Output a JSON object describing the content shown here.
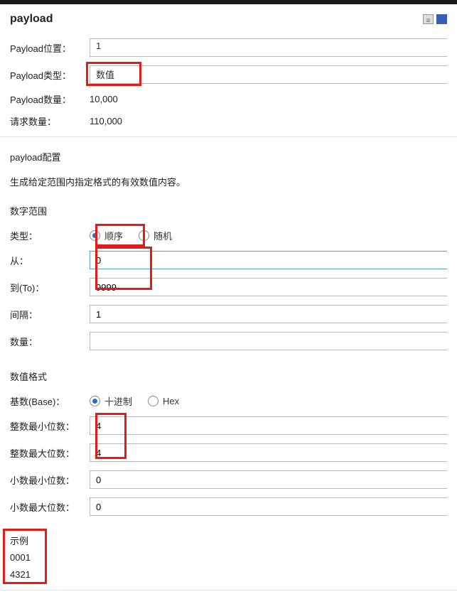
{
  "header": {
    "title": "payload"
  },
  "fields": {
    "position_label": "Payload位置：",
    "position_value": "1",
    "type_label": "Payload类型：",
    "type_value": "数值",
    "count_label": "Payload数量：",
    "count_value": "10,000",
    "request_label": "请求数量：",
    "request_value": "110,000"
  },
  "config": {
    "title": "payload配置",
    "description": "生成给定范围内指定格式的有效数值内容。"
  },
  "range": {
    "title": "数字范围",
    "type_label": "类型：",
    "seq_label": "顺序",
    "rand_label": "随机",
    "from_label": "从：",
    "from_value": "0",
    "to_label": "到(To)：",
    "to_value": "9999",
    "step_label": "间隔：",
    "step_value": "1",
    "qty_label": "数量：",
    "qty_value": ""
  },
  "format": {
    "title": "数值格式",
    "base_label": "基数(Base)：",
    "dec_label": "十进制",
    "hex_label": "Hex",
    "int_min_label": "整数最小位数：",
    "int_min_value": "4",
    "int_max_label": "整数最大位数：",
    "int_max_value": "4",
    "frac_min_label": "小数最小位数：",
    "frac_min_value": "0",
    "frac_max_label": "小数最大位数：",
    "frac_max_value": "0"
  },
  "example": {
    "title": "示例",
    "line1": "0001",
    "line2": "4321"
  }
}
